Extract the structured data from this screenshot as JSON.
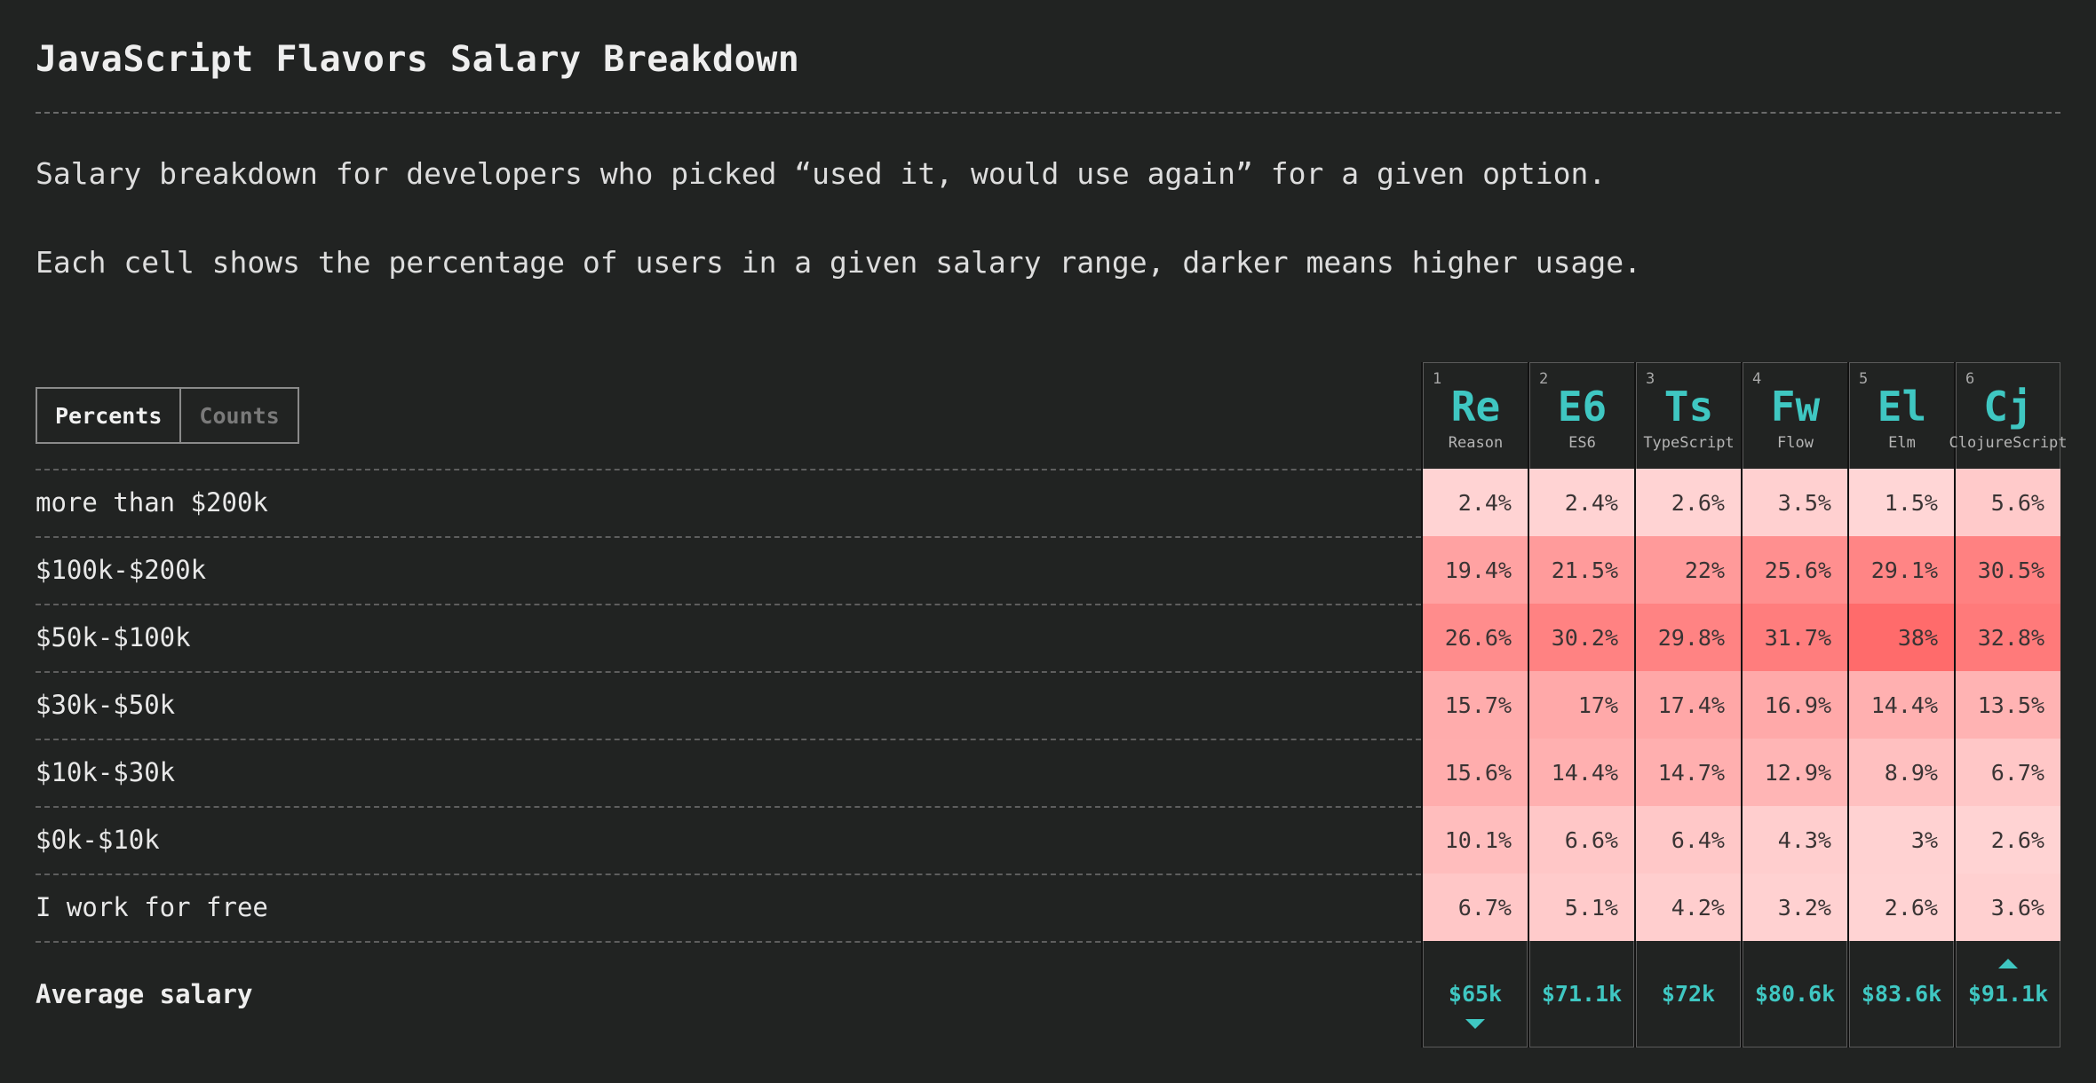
{
  "title": "JavaScript Flavors Salary Breakdown",
  "intro": [
    "Salary breakdown for developers who picked “used it, would use again” for a given option.",
    "Each cell shows the percentage of users in a given salary range, darker means higher usage."
  ],
  "toggle": {
    "percents_label": "Percents",
    "counts_label": "Counts",
    "selected": "Percents"
  },
  "rows": [
    "more than $200k",
    "$100k-$200k",
    "$50k-$100k",
    "$30k-$50k",
    "$10k-$30k",
    "$0k-$10k",
    "I work for free"
  ],
  "average_label": "Average salary",
  "columns": [
    {
      "num": "1",
      "abbr": "Re",
      "name": "Reason",
      "values": [
        2.4,
        19.4,
        26.6,
        15.7,
        15.6,
        10.1,
        6.7
      ],
      "average": "$65k",
      "marker": "lowest"
    },
    {
      "num": "2",
      "abbr": "E6",
      "name": "ES6",
      "values": [
        2.4,
        21.5,
        30.2,
        17,
        14.4,
        6.6,
        5.1
      ],
      "average": "$71.1k",
      "marker": ""
    },
    {
      "num": "3",
      "abbr": "Ts",
      "name": "TypeScript",
      "values": [
        2.6,
        22,
        29.8,
        17.4,
        14.7,
        6.4,
        4.2
      ],
      "average": "$72k",
      "marker": ""
    },
    {
      "num": "4",
      "abbr": "Fw",
      "name": "Flow",
      "values": [
        3.5,
        25.6,
        31.7,
        16.9,
        12.9,
        4.3,
        3.2
      ],
      "average": "$80.6k",
      "marker": ""
    },
    {
      "num": "5",
      "abbr": "El",
      "name": "Elm",
      "values": [
        1.5,
        29.1,
        38,
        14.4,
        8.9,
        3,
        2.6
      ],
      "average": "$83.6k",
      "marker": ""
    },
    {
      "num": "6",
      "abbr": "Cj",
      "name": "ClojureScript",
      "values": [
        5.6,
        30.5,
        32.8,
        13.5,
        6.7,
        2.6,
        3.6
      ],
      "average": "$91.1k",
      "marker": "highest"
    }
  ],
  "colors": {
    "background": "#212322",
    "accent": "#3fc7c2",
    "heat_low": "#ffd6d6",
    "heat_high": "#ff6b6b"
  }
}
